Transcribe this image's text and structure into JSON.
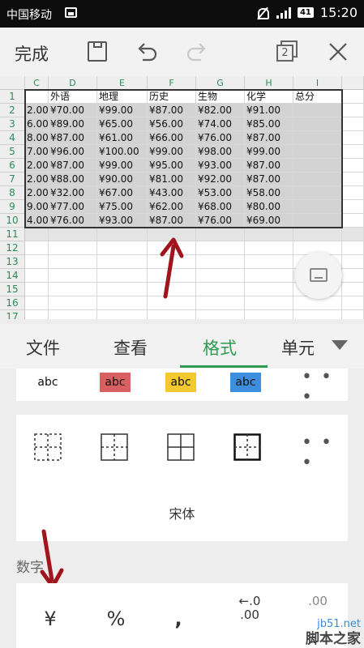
{
  "status_bar": {
    "carrier": "中国移动",
    "battery": "41",
    "time": "15:20"
  },
  "toolbar": {
    "done_label": "完成",
    "sheet_count": "2"
  },
  "sheet": {
    "columns": [
      "C",
      "D",
      "E",
      "F",
      "G",
      "H",
      "I"
    ],
    "rows": [
      "1",
      "2",
      "3",
      "4",
      "5",
      "6",
      "7",
      "8",
      "9",
      "10",
      "11",
      "12",
      "13",
      "14",
      "15",
      "16",
      "17"
    ],
    "header_row": [
      "",
      "外语",
      "地理",
      "历史",
      "生物",
      "化学",
      "总分"
    ],
    "data_rows": [
      [
        "2.00",
        "¥70.00",
        "¥99.00",
        "¥87.00",
        "¥82.00",
        "¥91.00",
        ""
      ],
      [
        "6.00",
        "¥89.00",
        "¥65.00",
        "¥56.00",
        "¥74.00",
        "¥85.00",
        ""
      ],
      [
        "8.00",
        "¥87.00",
        "¥61.00",
        "¥66.00",
        "¥76.00",
        "¥87.00",
        ""
      ],
      [
        "7.00",
        "¥96.00",
        "¥100.00",
        "¥99.00",
        "¥98.00",
        "¥99.00",
        ""
      ],
      [
        "2.00",
        "¥87.00",
        "¥99.00",
        "¥95.00",
        "¥93.00",
        "¥87.00",
        ""
      ],
      [
        "2.00",
        "¥88.00",
        "¥90.00",
        "¥81.00",
        "¥92.00",
        "¥87.00",
        ""
      ],
      [
        "2.00",
        "¥32.00",
        "¥67.00",
        "¥43.00",
        "¥53.00",
        "¥58.00",
        ""
      ],
      [
        "9.00",
        "¥77.00",
        "¥75.00",
        "¥62.00",
        "¥68.00",
        "¥80.00",
        ""
      ],
      [
        "4.00",
        "¥76.00",
        "¥93.00",
        "¥87.00",
        "¥76.00",
        "¥69.00",
        ""
      ]
    ]
  },
  "tabs": [
    "文件",
    "查看",
    "格式",
    "单元"
  ],
  "active_tab": "格式",
  "format_panel": {
    "text_styles": [
      {
        "label": "abc",
        "bg": "#ffffff"
      },
      {
        "label": "abc",
        "bg": "#d96060"
      },
      {
        "label": "abc",
        "bg": "#f2c92e"
      },
      {
        "label": "abc",
        "bg": "#3d8fde"
      }
    ],
    "more_label": "• • •",
    "font_name": "宋体",
    "number_section_label": "数字",
    "number_formats": [
      "¥",
      "%",
      ",",
      "←.0\n.00",
      ".00"
    ]
  },
  "watermark": {
    "line1": "jb51.net",
    "line2": "脚本之家"
  },
  "colors": {
    "accent": "#2e9b50",
    "arrow": "#a0141e",
    "selection": "#d3d3d3"
  }
}
